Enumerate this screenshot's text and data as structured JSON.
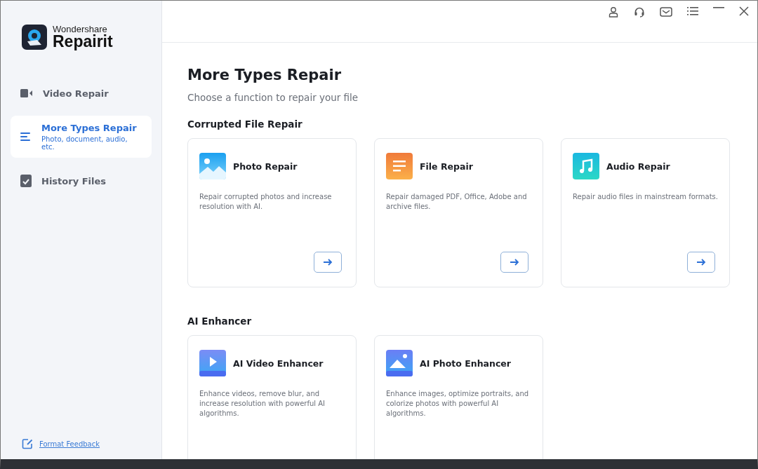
{
  "app": {
    "brand_top": "Wondershare",
    "brand_name": "Repairit"
  },
  "sidebar": {
    "items": [
      {
        "kind": "video",
        "label": "Video Repair",
        "selected": false
      },
      {
        "kind": "list",
        "label": "More Types Repair",
        "subtitle": "Photo, document, audio, etc.",
        "selected": true
      },
      {
        "kind": "history",
        "label": "History Files",
        "selected": false
      }
    ],
    "feedback_link": "Format Feedback"
  },
  "page": {
    "title": "More Types Repair",
    "subtitle": "Choose a function to repair your file",
    "sections": [
      {
        "heading": "Corrupted File Repair",
        "cards": [
          {
            "kind": "photo",
            "title": "Photo Repair",
            "description": "Repair corrupted photos and increase resolution with AI."
          },
          {
            "kind": "file",
            "title": "File Repair",
            "description": "Repair damaged PDF, Office, Adobe and archive files."
          },
          {
            "kind": "audio",
            "title": "Audio Repair",
            "description": "Repair audio files in mainstream formats."
          }
        ]
      },
      {
        "heading": "AI Enhancer",
        "cards": [
          {
            "kind": "ai-video",
            "title": "AI Video Enhancer",
            "description": "Enhance videos, remove blur, and increase resolution with powerful AI algorithms."
          },
          {
            "kind": "ai-photo",
            "title": "AI Photo Enhancer",
            "description": "Enhance images, optimize portraits, and colorize photos with powerful AI algorithms."
          }
        ]
      }
    ]
  }
}
